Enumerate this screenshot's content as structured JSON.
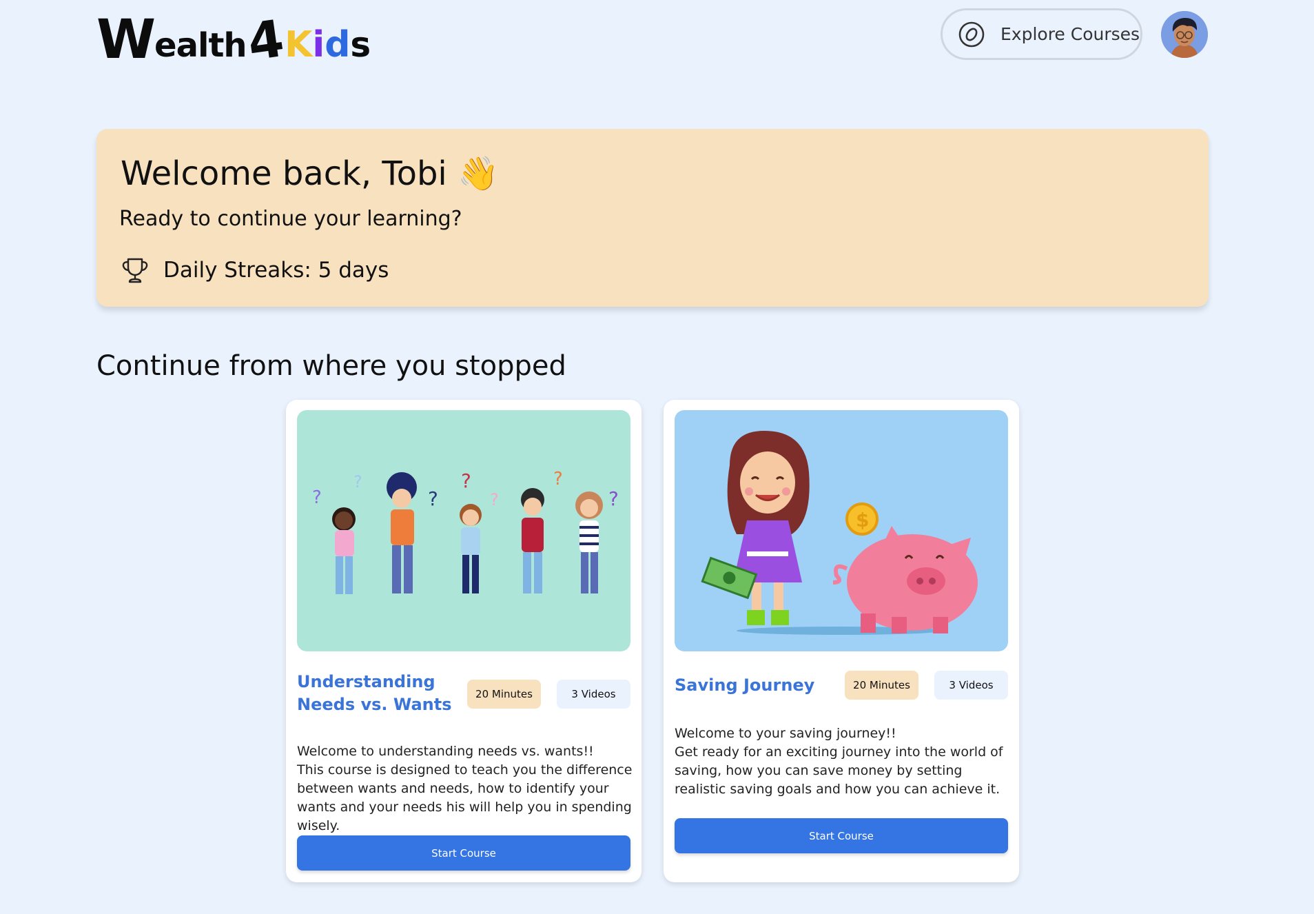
{
  "header": {
    "logo": {
      "w": "W",
      "ealth": "ealth",
      "four": "4",
      "k": "K",
      "i": "i",
      "d": "d",
      "s": "s"
    },
    "explore_label": "Explore Courses"
  },
  "welcome": {
    "title": "Welcome back, Tobi 👋",
    "subtitle": "Ready to continue your learning?",
    "streak": "Daily Streaks: 5 days"
  },
  "section_title": "Continue from where you stopped",
  "courses": [
    {
      "title": "Understanding Needs vs. Wants",
      "duration": "20 Minutes",
      "videos": "3 Videos",
      "desc_line1": "Welcome to understanding needs vs. wants!!",
      "desc_line2": "This course is designed to teach you the difference between wants and needs, how to identify your wants and your needs his will help you in spending wisely.",
      "button": "Start Course"
    },
    {
      "title": "Saving Journey",
      "duration": "20 Minutes",
      "videos": "3 Videos",
      "desc_line1": "Welcome to your saving journey!!",
      "desc_line2": "Get ready for an exciting journey into the world of saving, how you can save money by setting realistic saving goals and how you can achieve it.",
      "button": "Start Course"
    }
  ],
  "colors": {
    "page_bg": "#eaf2fd",
    "banner_bg": "#f8e1bf",
    "accent_blue": "#3474e3",
    "title_blue": "#3a74d8"
  }
}
